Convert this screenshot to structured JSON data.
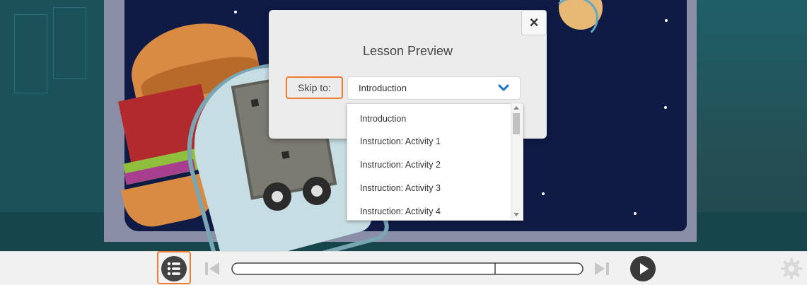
{
  "modal": {
    "title": "Lesson Preview",
    "skip_label": "Skip to:",
    "selected": "Introduction",
    "close_symbol": "×",
    "options": [
      "Introduction",
      "Instruction: Activity 1",
      "Instruction: Activity 2",
      "Instruction: Activity 3",
      "Instruction: Activity 4"
    ]
  },
  "controls": {
    "menu_icon": "list-icon",
    "back_icon": "skip-back-icon",
    "forward_icon": "skip-forward-icon",
    "play_icon": "play-icon",
    "settings_icon": "gear-icon",
    "progress": 0.75
  },
  "colors": {
    "highlight": "#ef7b2e",
    "chevron": "#1a73c8",
    "dark_button": "#3a3a3a"
  }
}
